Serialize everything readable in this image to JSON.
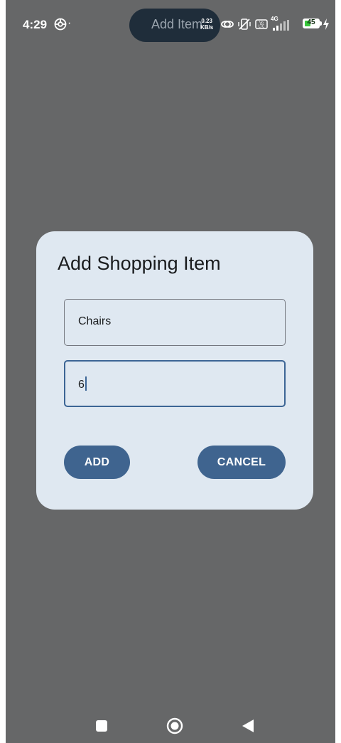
{
  "status_bar": {
    "time": "4:29",
    "net_speed_value": "0.23",
    "net_speed_unit": "KB/s",
    "network": "4G",
    "battery_level": 45,
    "battery_level_label": "45",
    "icons": [
      "chrome-like-icon",
      "link-icon",
      "vibrate-off-icon",
      "volte-icon",
      "signal-icon",
      "battery-icon",
      "charging-icon"
    ]
  },
  "island": {
    "label": "Add Item"
  },
  "dialog": {
    "title": "Add Shopping Item",
    "name_field": {
      "value": "Chairs"
    },
    "quantity_field": {
      "value": "6"
    },
    "add_label": "ADD",
    "cancel_label": "CANCEL"
  },
  "nav_bar": {
    "icons": [
      "recents-square-icon",
      "home-circle-icon",
      "back-triangle-icon"
    ]
  },
  "colors": {
    "background": "#666768",
    "dialog": "#dfe8f1",
    "button": "#3f648f",
    "focus_border": "#3c6595",
    "battery_fill": "#38c83b"
  }
}
